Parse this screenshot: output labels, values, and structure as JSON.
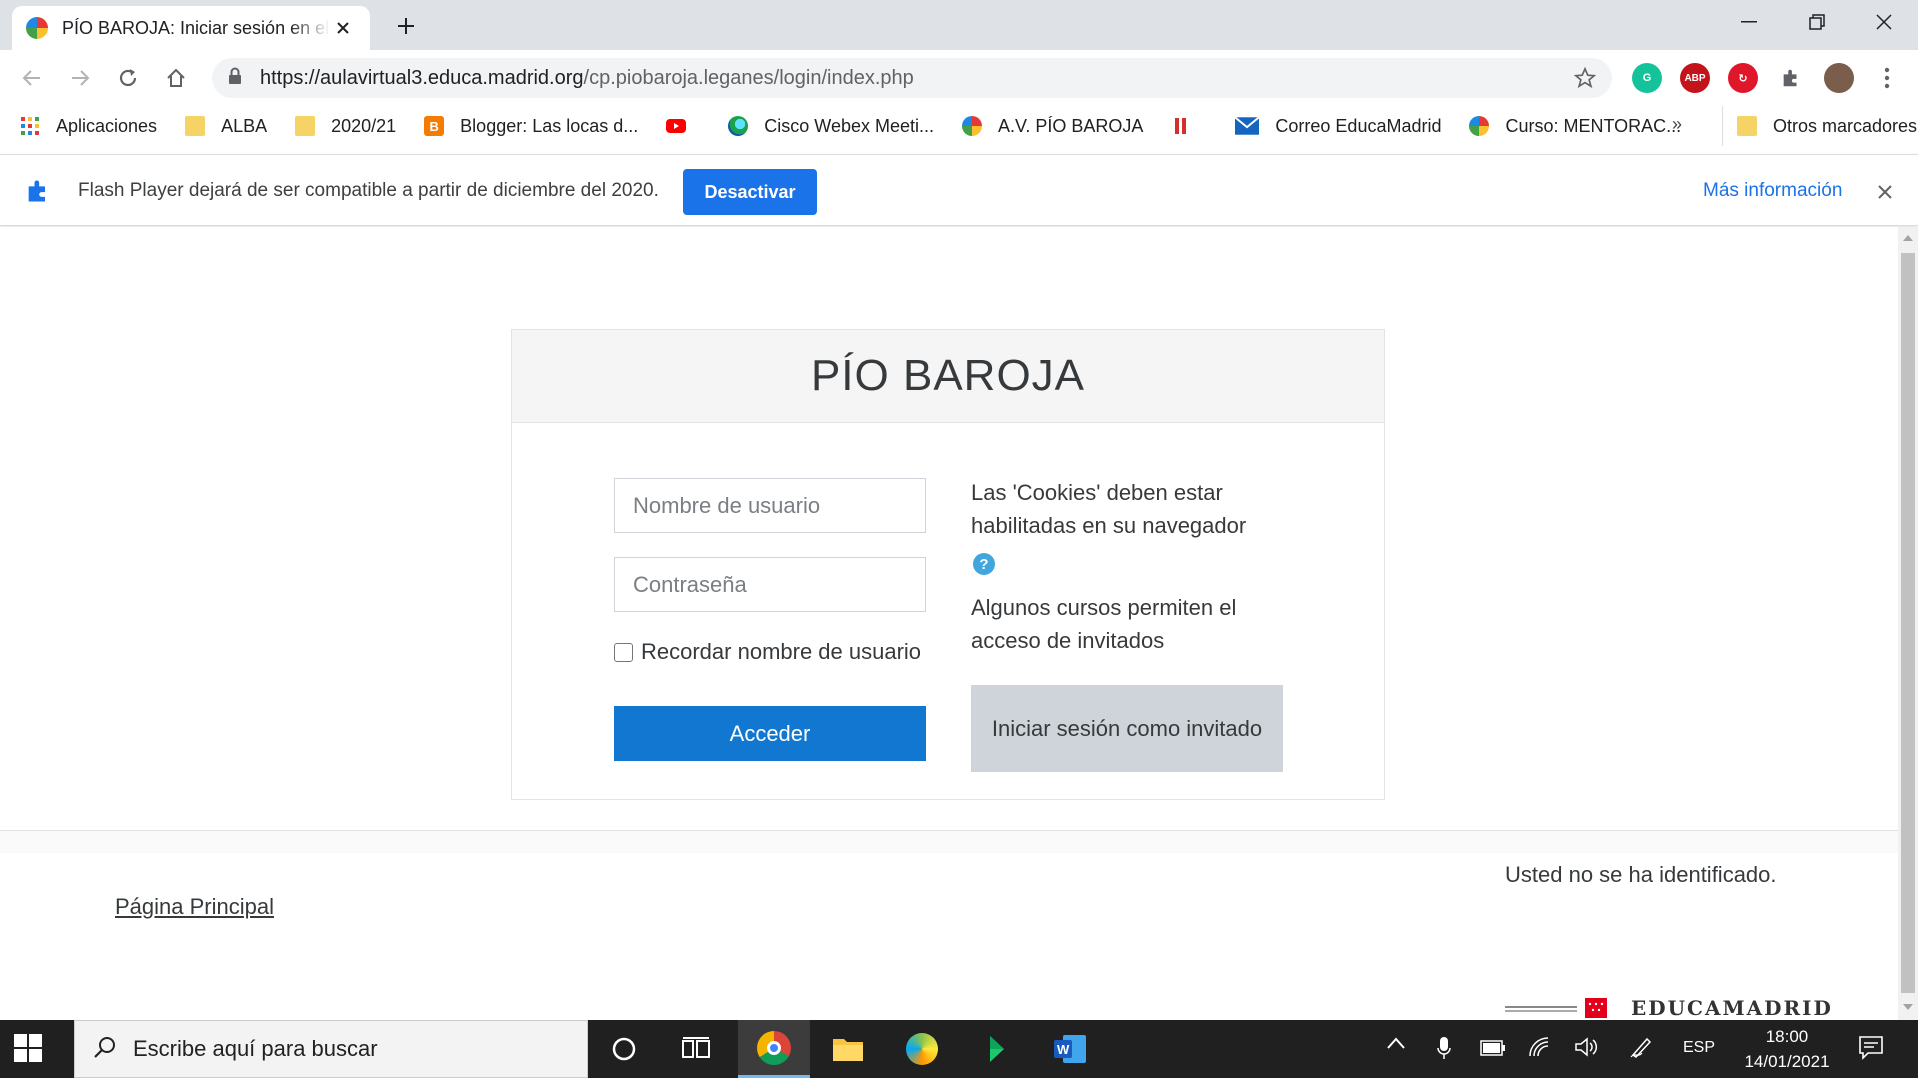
{
  "browser": {
    "tab_title": "PÍO BAROJA: Iniciar sesión en el sitio",
    "url_host": "https://aulavirtual3.educa.madrid.org",
    "url_path": "/cp.piobaroja.leganes/login/index.php"
  },
  "bookmarks": {
    "items": [
      {
        "label": "Aplicaciones",
        "icon": "apps-grid-icon"
      },
      {
        "label": "ALBA",
        "icon": "folder-icon"
      },
      {
        "label": "2020/21",
        "icon": "folder-icon"
      },
      {
        "label": "Blogger: Las locas d...",
        "icon": "blogger-icon"
      },
      {
        "label": "",
        "icon": "youtube-icon"
      },
      {
        "label": "Cisco Webex Meeti...",
        "icon": "webex-icon"
      },
      {
        "label": "A.V. PÍO BAROJA",
        "icon": "moodle-favicon-icon"
      },
      {
        "label": "",
        "icon": "bookmark-red-icon"
      },
      {
        "label": "Correo EducaMadrid",
        "icon": "mail-icon"
      },
      {
        "label": "Curso: MENTORAC...",
        "icon": "moodle-favicon-icon"
      }
    ],
    "more": "»",
    "other": "Otros marcadores"
  },
  "infobar": {
    "message": "Flash Player dejará de ser compatible a partir de diciembre del 2020.",
    "button": "Desactivar",
    "link": "Más información"
  },
  "login": {
    "site_title": "PÍO BAROJA",
    "username_placeholder": "Nombre de usuario",
    "password_placeholder": "Contraseña",
    "remember_label": "Recordar nombre de usuario",
    "login_button": "Acceder",
    "cookies_notice": "Las 'Cookies' deben estar habilitadas en su navegador",
    "guest_notice": "Algunos cursos permiten el acceso de invitados",
    "guest_button": "Iniciar sesión como invitado"
  },
  "footer": {
    "login_status": "Usted no se ha identificado.",
    "home_link": "Página Principal",
    "logo_text": "EDUCAMADRID"
  },
  "taskbar": {
    "search_placeholder": "Escribe aquí para buscar",
    "language": "ESP",
    "time": "18:00",
    "date": "14/01/2021"
  },
  "colors": {
    "accent": "#1177d1",
    "chrome_blue": "#1a73e8",
    "guest_button": "#ced4da"
  }
}
